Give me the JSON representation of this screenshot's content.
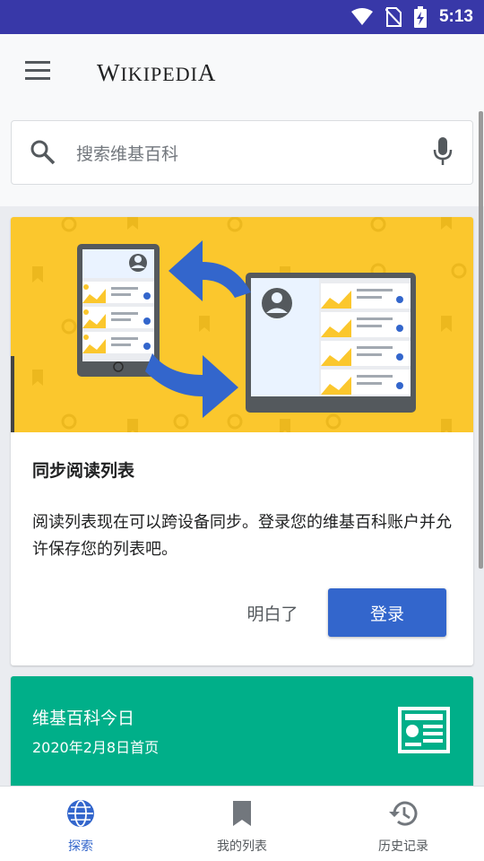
{
  "status_bar": {
    "time": "5:13",
    "icons": [
      "wifi-icon",
      "no-sim-icon",
      "battery-charging-icon"
    ]
  },
  "app_bar": {
    "menu_icon": "menu-icon",
    "wordmark": "Wikipedia"
  },
  "search": {
    "placeholder": "搜索维基百科",
    "search_icon": "search-icon",
    "voice_icon": "microphone-icon"
  },
  "sync_card": {
    "title": "同步阅读列表",
    "body": "阅读列表现在可以跨设备同步。登录您的维基百科账户并允许保存您的列表吧。",
    "dismiss_label": "明白了",
    "login_label": "登录"
  },
  "today_card": {
    "title": "维基百科今日",
    "subtitle": "2020年2月8日首页",
    "icon": "newspaper-icon"
  },
  "bottom_nav": {
    "items": [
      {
        "label": "探索",
        "icon": "globe-icon",
        "active": true
      },
      {
        "label": "我的列表",
        "icon": "bookmark-icon",
        "active": false
      },
      {
        "label": "历史记录",
        "icon": "history-icon",
        "active": false
      }
    ]
  },
  "colors": {
    "status_bar": "#3838a8",
    "accent": "#3366cc",
    "illustration_bg": "#fbc72d",
    "featured_card": "#00af89"
  }
}
